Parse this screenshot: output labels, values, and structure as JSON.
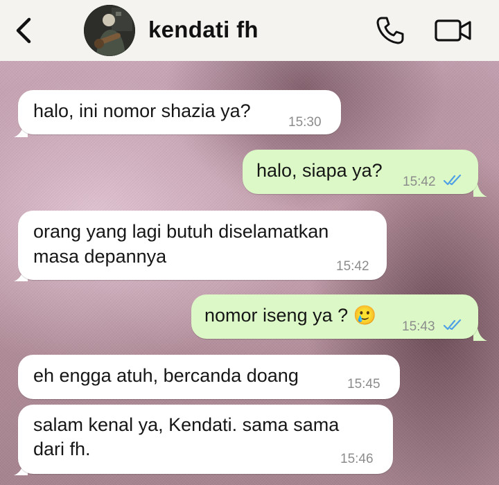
{
  "header": {
    "contact_name": "kendati fh",
    "back_icon": "chevron-left-icon",
    "call_icon": "phone-icon",
    "video_icon": "video-camera-icon"
  },
  "messages": [
    {
      "direction": "incoming",
      "text": "halo, ini nomor shazia ya?",
      "time": "15:30"
    },
    {
      "direction": "outgoing",
      "text": "halo, siapa ya?",
      "time": "15:42",
      "status": "read"
    },
    {
      "direction": "incoming",
      "text_line1": "orang yang lagi butuh diselamatkan",
      "text_line2": "masa depannya",
      "time": "15:42"
    },
    {
      "direction": "outgoing",
      "text": "nomor iseng ya ? 🥲",
      "time": "15:43",
      "status": "read"
    },
    {
      "direction": "incoming",
      "text": "eh engga atuh, bercanda doang",
      "time": "15:45"
    },
    {
      "direction": "incoming",
      "text_line1": "salam kenal ya, Kendati. sama sama",
      "text_line2": "dari fh.",
      "time": "15:46"
    }
  ],
  "colors": {
    "incoming_bubble": "#ffffff",
    "outgoing_bubble": "#dbf8c6",
    "read_ticks": "#4fa0e6",
    "header_bg": "#f4f3f0"
  }
}
